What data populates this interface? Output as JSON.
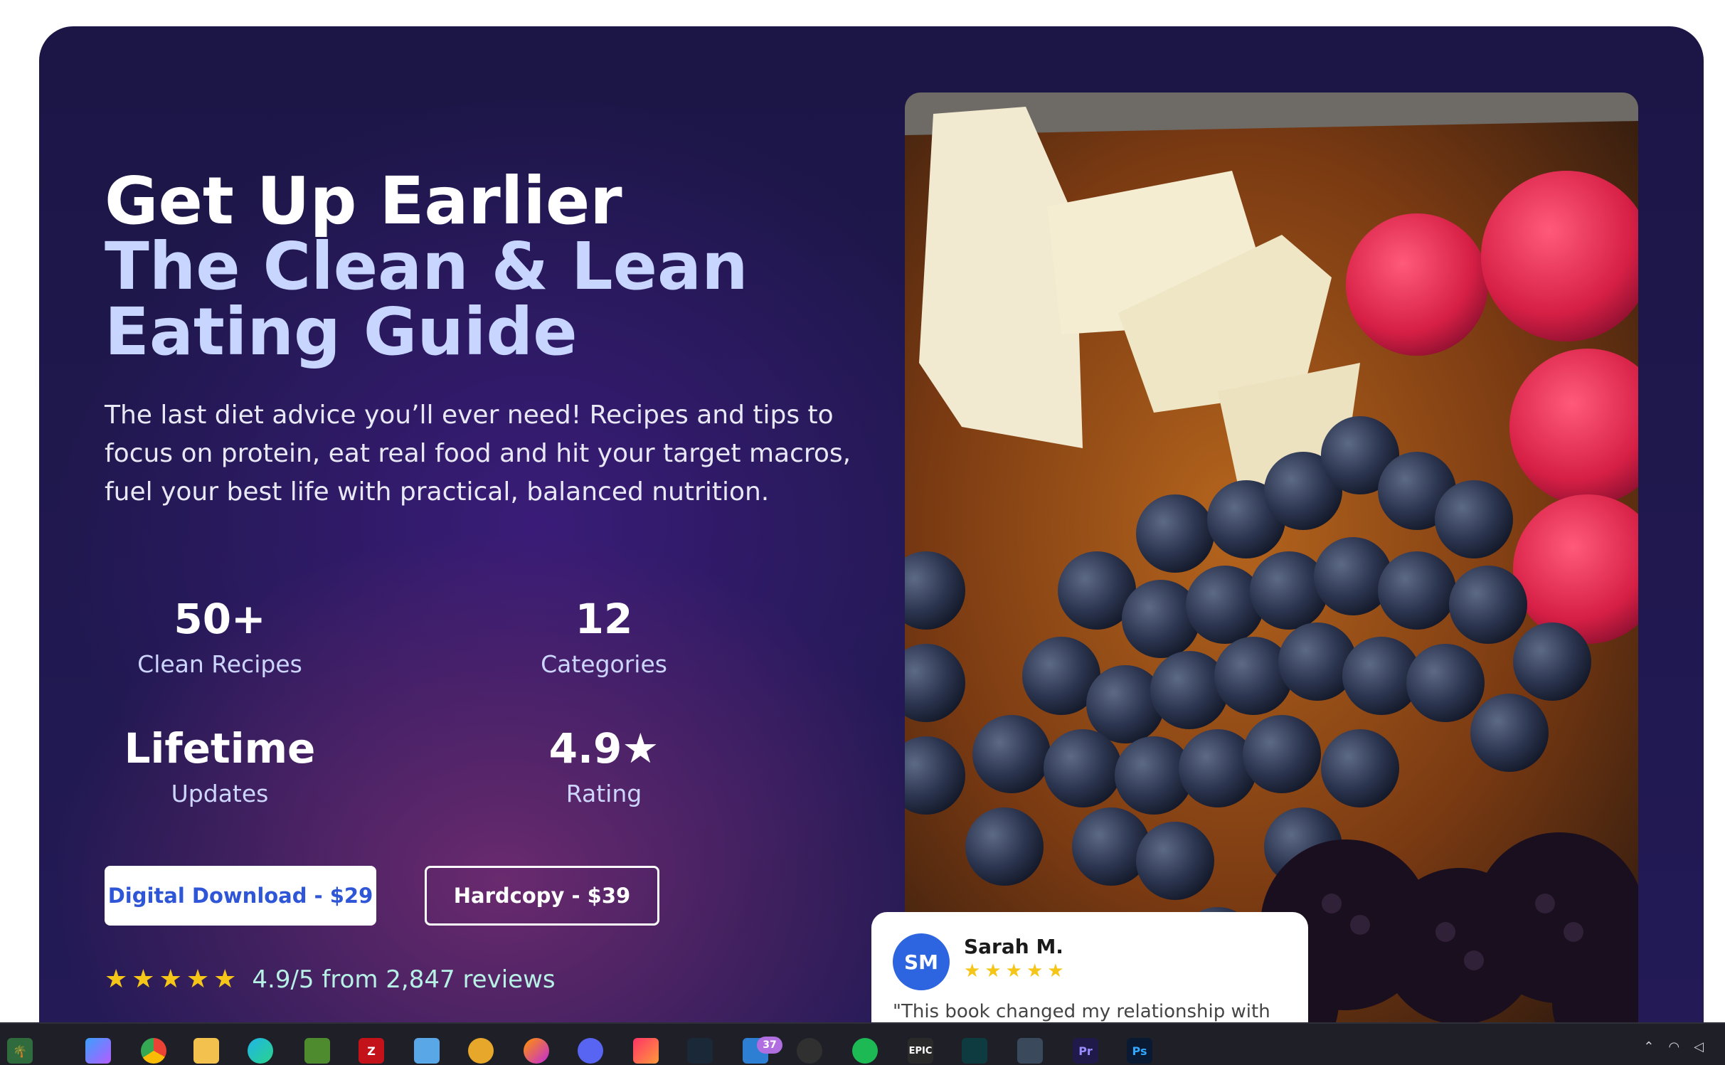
{
  "hero": {
    "title_line1": "Get Up Earlier",
    "title_line2": "The Clean & Lean",
    "title_line3": "Eating Guide",
    "description": "The last diet advice you’ll ever need! Recipes and tips to focus on protein, eat real food and hit your target macros, fuel your best life with practical, balanced nutrition."
  },
  "stats": [
    {
      "value": "50+",
      "label": "Clean Recipes"
    },
    {
      "value": "12",
      "label": "Categories"
    },
    {
      "value": "Lifetime",
      "label": "Updates"
    },
    {
      "value": "4.9★",
      "label": "Rating"
    }
  ],
  "buttons": {
    "digital": "Digital Download - $29",
    "hardcopy": "Hardcopy - $39"
  },
  "rating": {
    "stars": 5,
    "text": "4.9/5 from 2,847 reviews"
  },
  "review": {
    "initials": "SM",
    "name": "Sarah M.",
    "stars": 5,
    "quote": "\"This book changed my relationship with"
  },
  "taskbar": {
    "icons": [
      "palm-tree-widget-icon",
      "copilot-icon",
      "chrome-icon",
      "file-explorer-icon",
      "edge-icon",
      "minecraft-icon",
      "filezilla-icon",
      "notepad-icon",
      "lightroom-sun-icon",
      "firefox-icon",
      "discord-icon",
      "creative-cloud-icon",
      "steam-icon",
      "mail-icon",
      "obs-icon",
      "spotify-icon",
      "epic-games-icon",
      "capcut-icon",
      "character-app-icon",
      "premiere-pro-icon",
      "photoshop-icon"
    ],
    "mail_badge": "37",
    "epic_label": "EPIC",
    "pr_label": "Pr",
    "ps_label": "Ps"
  },
  "colors": {
    "accent_title": "#c7d5ff",
    "button_text": "#2e56d6",
    "star": "#f5c518",
    "rating_text": "#b7f0e4",
    "avatar": "#2d64e0"
  }
}
